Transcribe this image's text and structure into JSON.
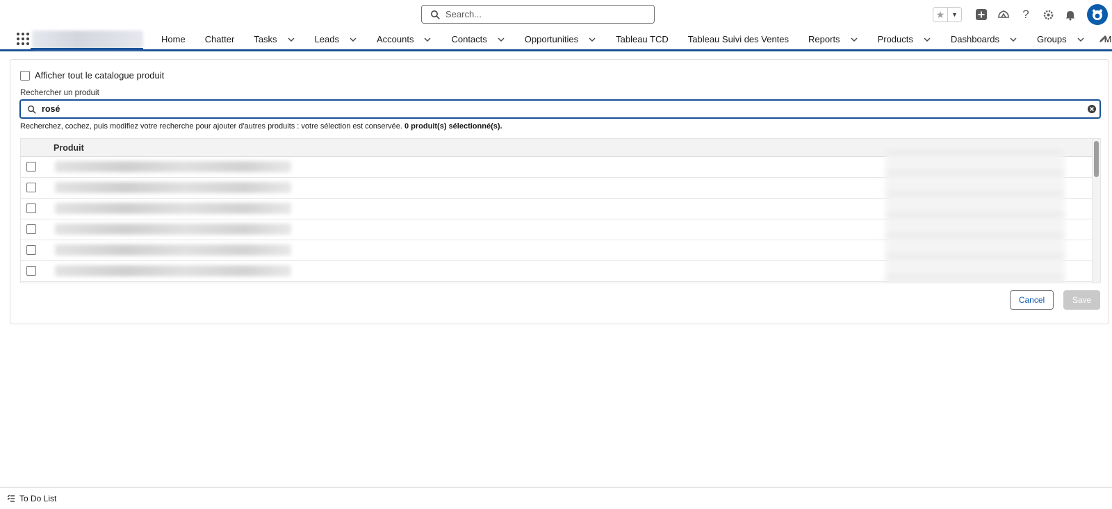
{
  "global_search": {
    "placeholder": "Search..."
  },
  "nav": {
    "items": [
      {
        "label": "Home",
        "dropdown": false
      },
      {
        "label": "Chatter",
        "dropdown": false
      },
      {
        "label": "Tasks",
        "dropdown": true
      },
      {
        "label": "Leads",
        "dropdown": true
      },
      {
        "label": "Accounts",
        "dropdown": true
      },
      {
        "label": "Contacts",
        "dropdown": true
      },
      {
        "label": "Opportunities",
        "dropdown": true
      },
      {
        "label": "Tableau TCD",
        "dropdown": false
      },
      {
        "label": "Tableau Suivi des Ventes",
        "dropdown": false
      },
      {
        "label": "Reports",
        "dropdown": true
      },
      {
        "label": "Products",
        "dropdown": true
      },
      {
        "label": "Dashboards",
        "dropdown": true
      },
      {
        "label": "Groups",
        "dropdown": true
      }
    ],
    "more_label": "More"
  },
  "product_picker": {
    "show_all_label": "Afficher tout le catalogue produit",
    "search_label": "Rechercher un produit",
    "search_value": "rosé",
    "helper_text": "Recherchez, cochez, puis modifiez votre recherche pour ajouter d'autres produits : votre sélection est conservée. ",
    "selected_count_text": "0 produit(s) sélectionné(s).",
    "table": {
      "column_header": "Produit",
      "row_count": 6
    },
    "cancel_label": "Cancel",
    "save_label": "Save"
  },
  "utility_bar": {
    "todo_label": "To Do List"
  },
  "colors": {
    "brand": "#1b5297",
    "link": "#0b5cab",
    "avatar": "#0b5cab"
  }
}
